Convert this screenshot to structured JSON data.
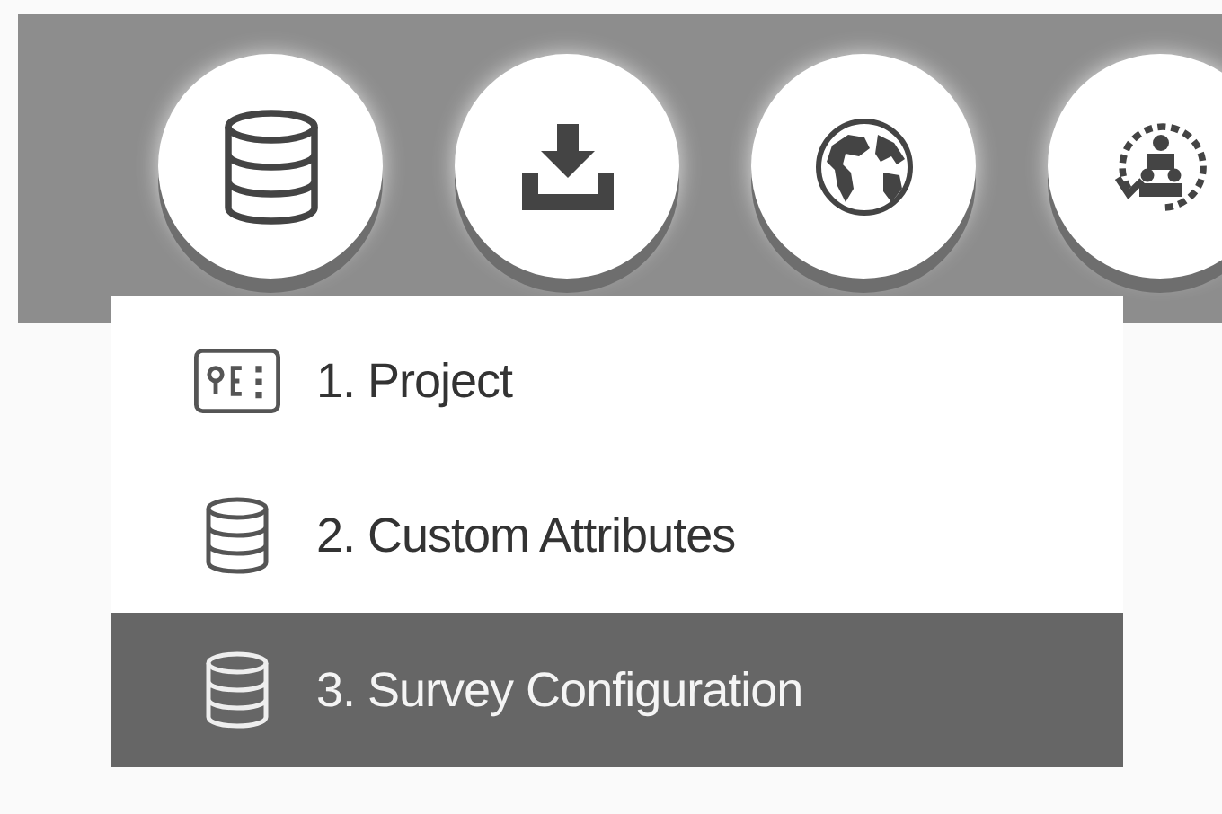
{
  "toolbar": {
    "buttons": [
      {
        "kind": "database"
      },
      {
        "kind": "download"
      },
      {
        "kind": "globe"
      },
      {
        "kind": "sync"
      }
    ]
  },
  "menu": {
    "items": [
      {
        "label": "1. Project",
        "kind": "form",
        "selected": false
      },
      {
        "label": "2. Custom Attributes",
        "kind": "database",
        "selected": false
      },
      {
        "label": "3. Survey Configuration",
        "kind": "database",
        "selected": true
      }
    ]
  }
}
